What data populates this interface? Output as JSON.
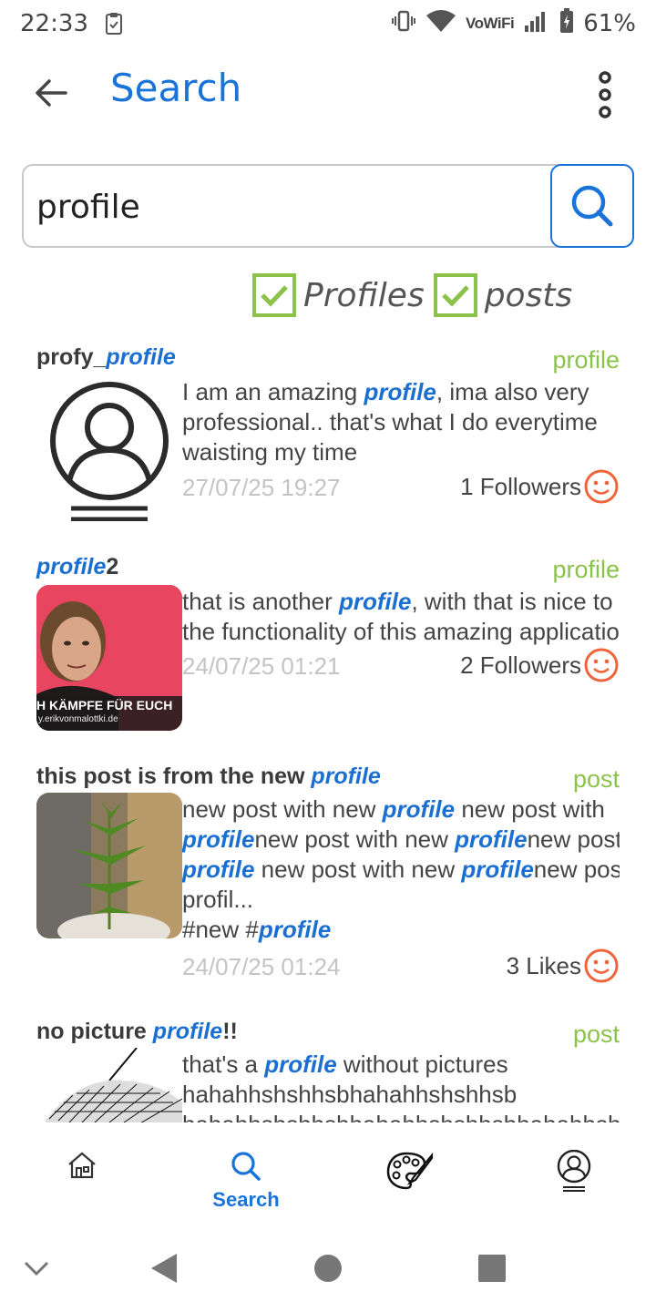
{
  "status_bar": {
    "time": "22:33",
    "network_label": "VoWiFi",
    "battery_percent": "61%",
    "icons": [
      "vibrate-icon",
      "wifi-icon",
      "signal-icon",
      "battery-icon"
    ]
  },
  "app_bar": {
    "title": "Search",
    "back_icon": "arrow-left-icon",
    "menu_icon": "more-vertical-icon"
  },
  "search": {
    "value": "profile",
    "placeholder": "",
    "button_icon": "search-icon"
  },
  "filters": [
    {
      "label": "Profiles",
      "checked": true
    },
    {
      "label": "posts",
      "checked": true
    }
  ],
  "results": [
    {
      "title_parts": [
        "profy_",
        "profile",
        ""
      ],
      "type": "profile",
      "text_lines": [
        [
          "I am an amazing ",
          "profile",
          ", ima also very"
        ],
        [
          "professional.. that's what I do everytime",
          "",
          ""
        ],
        [
          "waisting my time",
          "",
          ""
        ]
      ],
      "date": "27/07/25 19:27",
      "meta": "1 Followers",
      "thumb": "default-avatar-icon"
    },
    {
      "title_parts": [
        "",
        "profile",
        "2"
      ],
      "type": "profile",
      "text_lines": [
        [
          "that is another ",
          "profile",
          ", with that is nice to"
        ],
        [
          "the functionality of this amazing application",
          "",
          ""
        ]
      ],
      "date": "24/07/25 01:21",
      "meta": "2 Followers",
      "thumb_caption": "H KÄMPFE FÜR EUCH",
      "thumb_url_text": "y.erikvonmalottki.de"
    },
    {
      "title_parts": [
        "this post is from the new ",
        "profile",
        ""
      ],
      "type": "post",
      "text_lines": [
        [
          "new post with new ",
          "profile",
          " new post with"
        ],
        [
          "",
          "profile",
          "new post with new "
        ],
        [
          "",
          "profile",
          " new post with new "
        ],
        [
          "profil...",
          "",
          ""
        ],
        [
          "#new #",
          "profile",
          ""
        ]
      ],
      "text_line2_tail": [
        "profile",
        "new post"
      ],
      "text_line3_tail": [
        "profile",
        "new post"
      ],
      "date": "24/07/25 01:24",
      "meta": "3 Likes",
      "thumb": "plant-photo"
    },
    {
      "title_parts": [
        "no picture ",
        "profile",
        "!!"
      ],
      "type": "post",
      "text_lines": [
        [
          "that's a ",
          "profile",
          " without pictures"
        ],
        [
          "hahahhshshhsbhahahhshshhsb",
          "",
          ""
        ],
        [
          "hahahhshshhsbhahahhshshhsbhahahhshshhsb",
          "",
          ""
        ]
      ]
    }
  ],
  "bottom_nav": {
    "items": [
      {
        "icon": "home-icon",
        "label": ""
      },
      {
        "icon": "search-icon",
        "label": "Search",
        "active": true
      },
      {
        "icon": "palette-icon",
        "label": ""
      },
      {
        "icon": "profile-icon",
        "label": ""
      }
    ]
  },
  "system_nav": [
    "collapse-icon",
    "back-triangle-icon",
    "home-circle-icon",
    "recents-square-icon"
  ],
  "colors": {
    "accent": "#1a73d9",
    "highlight": "#1a6fd0",
    "type_label": "#8bc34a",
    "checkbox": "#8bc34a",
    "smiley": "#f0643c",
    "date": "#c4c4c4"
  }
}
